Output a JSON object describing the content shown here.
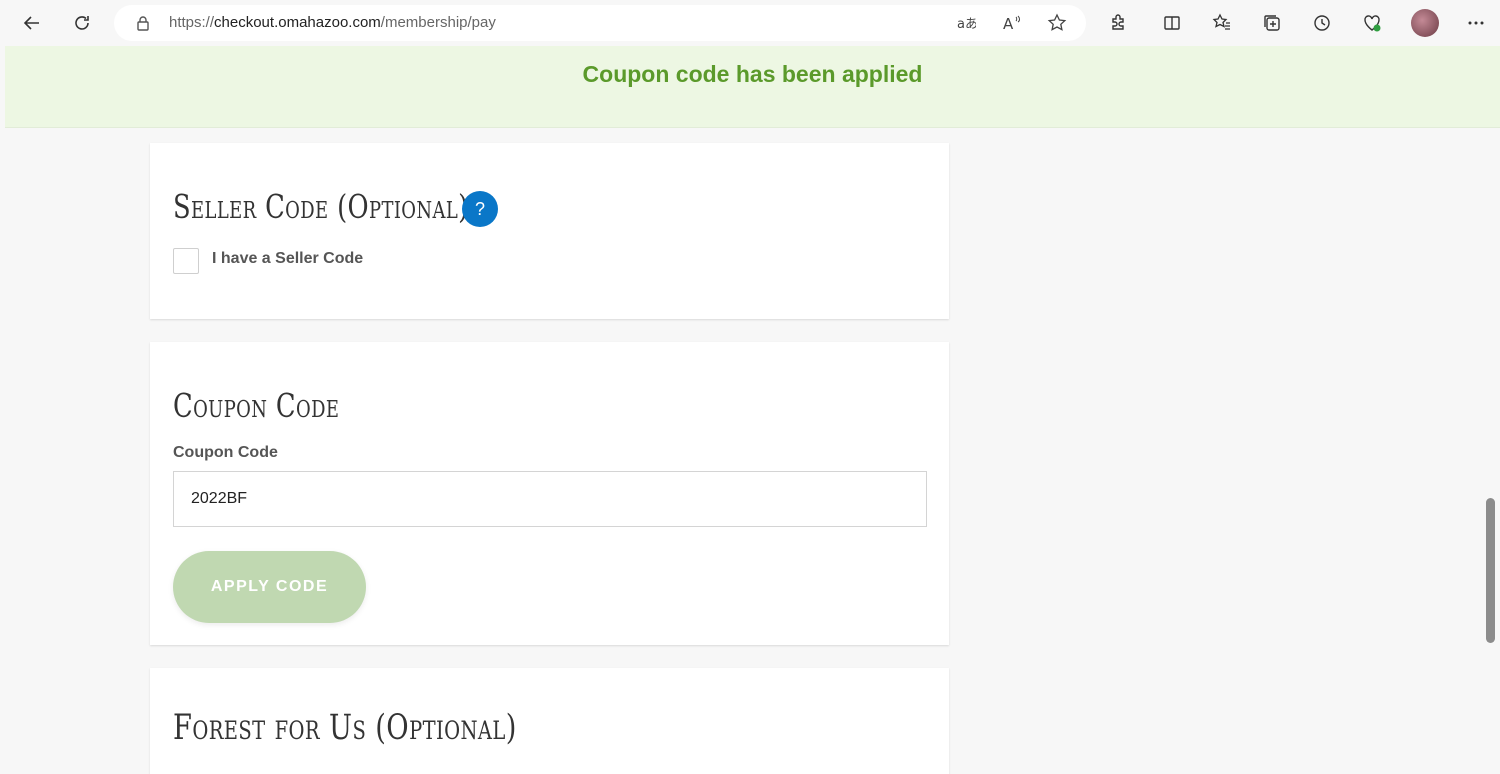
{
  "browser": {
    "url_prefix": "https://",
    "url_host": "checkout.omahazoo.com",
    "url_path": "/membership/pay"
  },
  "banner": {
    "message": "Coupon code has been applied"
  },
  "seller_section": {
    "title": "Seller Code (Optional)",
    "help_symbol": "?",
    "checkbox_label": "I have a Seller Code"
  },
  "coupon_section": {
    "title": "Coupon Code",
    "field_label": "Coupon Code",
    "field_value": "2022BF",
    "apply_label": "APPLY CODE"
  },
  "forest_section": {
    "title": "Forest for Us (Optional)"
  },
  "colors": {
    "banner_bg": "#edf7e3",
    "banner_text": "#5b9a2b",
    "help_button": "#0a77c8",
    "apply_button": "#c0d8b1"
  }
}
